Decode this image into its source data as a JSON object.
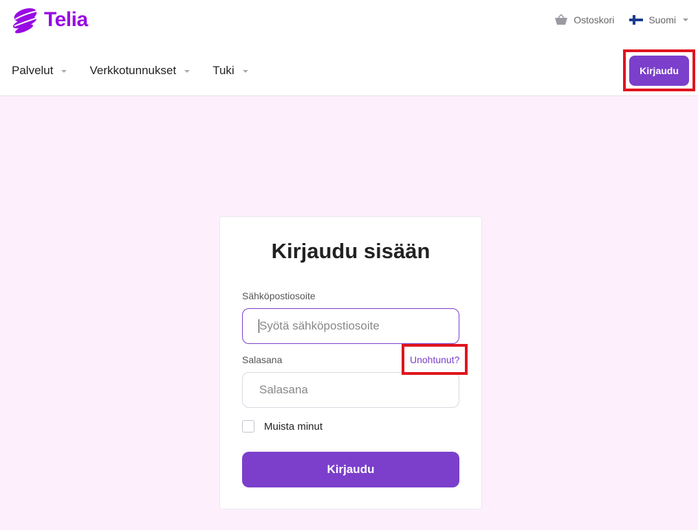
{
  "header": {
    "brand": "Telia",
    "cart_label": "Ostoskori",
    "language_label": "Suomi",
    "nav": [
      {
        "label": "Palvelut"
      },
      {
        "label": "Verkkotunnukset"
      },
      {
        "label": "Tuki"
      }
    ],
    "login_button": "Kirjaudu"
  },
  "login_form": {
    "title": "Kirjaudu sisään",
    "email_label": "Sähköpostiosoite",
    "email_placeholder": "Syötä sähköpostiosoite",
    "email_value": "",
    "password_label": "Salasana",
    "password_placeholder": "Salasana",
    "forgot_link": "Unohtunut?",
    "remember_label": "Muista minut",
    "remember_checked": false,
    "submit_label": "Kirjaudu"
  },
  "colors": {
    "brand_purple": "#990ae3",
    "button_purple": "#7b3fcc",
    "page_background": "#fdf0fc",
    "highlight_red": "#e0141e"
  },
  "icons": {
    "cart": "basket-icon",
    "language": "finland-flag-icon"
  }
}
